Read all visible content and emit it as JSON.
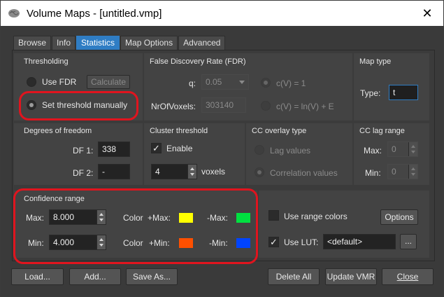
{
  "window": {
    "title": "Volume Maps - [untitled.vmp]",
    "close_glyph": "✕"
  },
  "tabs": [
    "Browse",
    "Info",
    "Statistics",
    "Map Options",
    "Advanced"
  ],
  "thresholding": {
    "title": "Thresholding",
    "use_fdr": "Use FDR",
    "calculate": "Calculate",
    "set_manual": "Set threshold manually"
  },
  "fdr": {
    "title": "False Discovery Rate (FDR)",
    "q_label": "q:",
    "q_value": "0.05",
    "nr_label": "NrOfVoxels:",
    "nr_value": "303140",
    "cv1": "c(V) = 1",
    "cv2": "c(V) = ln(V) + E"
  },
  "map_type": {
    "title": "Map type",
    "type_label": "Type:",
    "type_value": "t"
  },
  "dof": {
    "title": "Degrees of freedom",
    "df1_label": "DF 1:",
    "df1_value": "338",
    "df2_label": "DF 2:",
    "df2_value": "-"
  },
  "cluster": {
    "title": "Cluster threshold",
    "enable": "Enable",
    "value": "4",
    "unit": "voxels"
  },
  "cc_overlay": {
    "title": "CC overlay type",
    "lag": "Lag values",
    "corr": "Correlation values"
  },
  "cc_lag": {
    "title": "CC lag range",
    "max_label": "Max:",
    "max_value": "0",
    "min_label": "Min:",
    "min_value": "0"
  },
  "confidence": {
    "title": "Confidence range",
    "max_label": "Max:",
    "max_value": "8.000",
    "min_label": "Min:",
    "min_value": "4.000",
    "color_label": "Color",
    "pos_max": "+Max:",
    "neg_max": "-Max:",
    "pos_min": "+Min:",
    "neg_min": "-Min:",
    "colors": {
      "pos_max": "#ffff00",
      "neg_max": "#00e040",
      "pos_min": "#ff5000",
      "neg_min": "#0044ff"
    }
  },
  "range_colors": {
    "use_range_colors": "Use range colors",
    "options": "Options",
    "use_lut": "Use LUT:",
    "lut_value": "<default>",
    "browse": "..."
  },
  "buttons": {
    "load": "Load...",
    "add": "Add...",
    "save_as": "Save As...",
    "delete_all": "Delete All",
    "update_vmr": "Update VMR",
    "close": "Close"
  },
  "highlight_color": "#e0141e",
  "accent_color": "#2f7dc4"
}
